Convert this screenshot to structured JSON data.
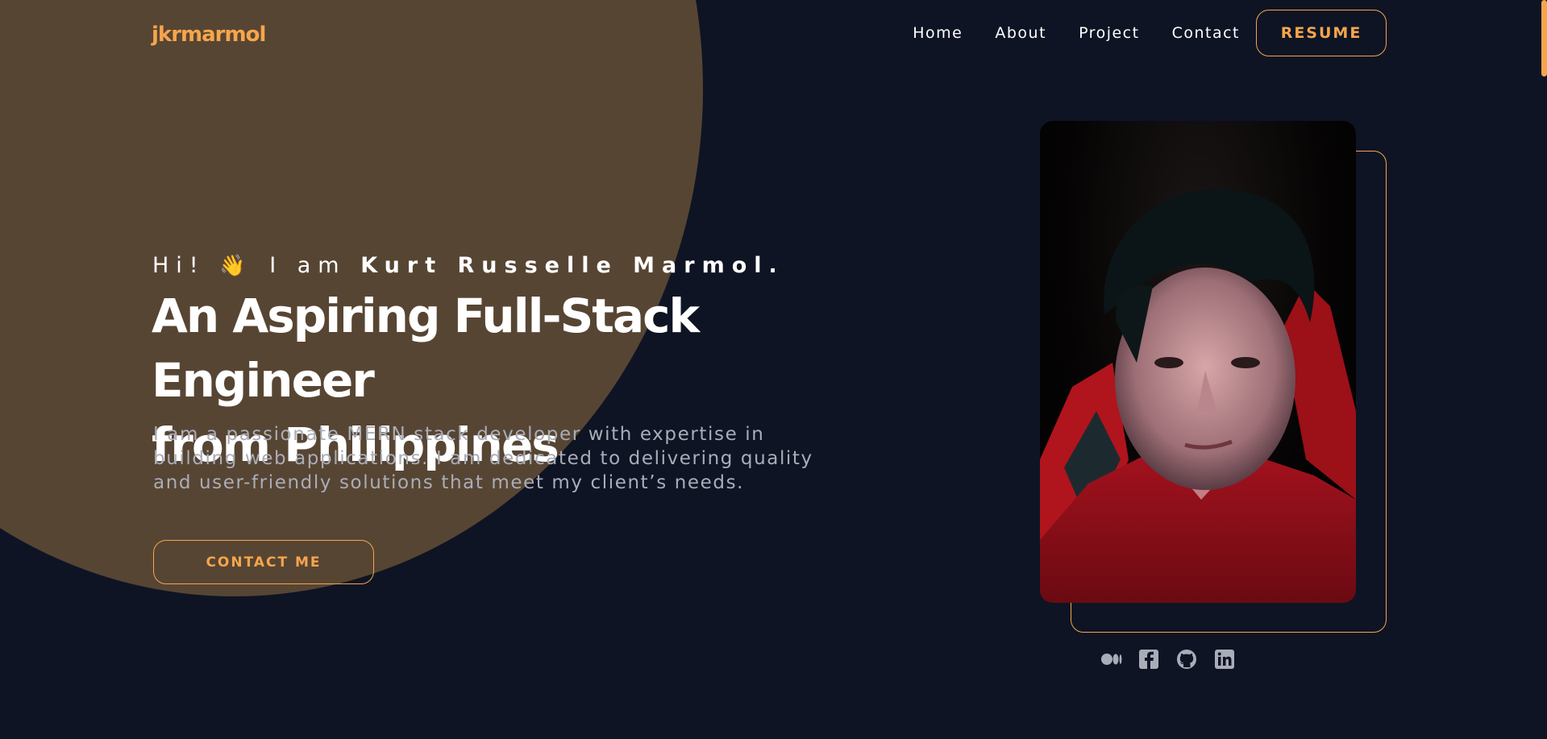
{
  "brand": {
    "logo_text": "jkrmarmol"
  },
  "nav": {
    "links": [
      "Home",
      "About",
      "Project",
      "Contact"
    ],
    "resume_label": "RESUME"
  },
  "hero": {
    "greeting_prefix": "Hi!",
    "wave_emoji": "👋",
    "greeting_mid": "I am",
    "name": "Kurt Russelle Marmol.",
    "headline_line1": "An Aspiring Full-Stack Engineer",
    "headline_line2": "from Philippines",
    "intro": "I am a passionate MERN stack developer with expertise in building web applications. I am dedicated to delivering quality and user-friendly solutions that meet my client’s needs.",
    "contact_label": "CONTACT ME"
  },
  "socials": [
    "medium-icon",
    "facebook-icon",
    "github-icon",
    "linkedin-icon"
  ],
  "colors": {
    "accent": "#f6a54c",
    "background": "#0e1424",
    "blob": "#574533"
  }
}
